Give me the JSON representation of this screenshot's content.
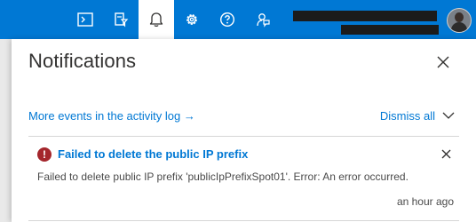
{
  "topbar": {
    "icons": [
      {
        "name": "cloud-shell-icon"
      },
      {
        "name": "directory-filter-icon"
      },
      {
        "name": "notifications-bell-icon"
      },
      {
        "name": "settings-gear-icon"
      },
      {
        "name": "help-icon"
      },
      {
        "name": "feedback-icon"
      }
    ],
    "accent_color": "#0078d4",
    "active_icon": "notifications-bell-icon"
  },
  "panel": {
    "title": "Notifications",
    "more_events_label": "More events in the activity log →",
    "dismiss_label": "Dismiss all"
  },
  "notification": {
    "status": "error",
    "title": "Failed to delete the public IP prefix",
    "message": "Failed to delete public IP prefix 'publicIpPrefixSpot01'. Error: An error occurred.",
    "time": "an hour ago"
  }
}
